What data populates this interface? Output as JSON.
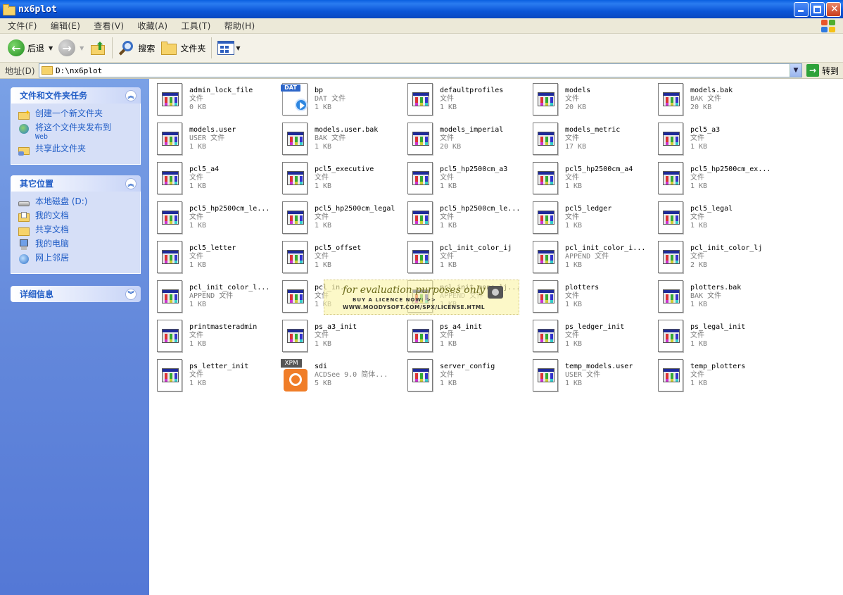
{
  "window": {
    "title": "nx6plot"
  },
  "menu": [
    "文件(F)",
    "编辑(E)",
    "查看(V)",
    "收藏(A)",
    "工具(T)",
    "帮助(H)"
  ],
  "toolbar": {
    "back_label": "后退",
    "search_label": "搜索",
    "folders_label": "文件夹"
  },
  "address": {
    "label": "地址(D)",
    "path": "D:\\nx6plot",
    "go_label": "转到"
  },
  "left_pane": {
    "tasks_title": "文件和文件夹任务",
    "tasks": [
      {
        "label": "创建一个新文件夹",
        "sub": ""
      },
      {
        "label": "将这个文件夹发布到",
        "sub": "Web"
      },
      {
        "label": "共享此文件夹",
        "sub": ""
      }
    ],
    "places_title": "其它位置",
    "places": [
      "本地磁盘 (D:)",
      "我的文档",
      "共享文档",
      "我的电脑",
      "网上邻居"
    ],
    "details_title": "详细信息"
  },
  "files": [
    {
      "name": "admin_lock_file",
      "type": "文件",
      "size": "0 KB",
      "icon": "doc"
    },
    {
      "name": "bp",
      "type": "DAT 文件",
      "size": "1 KB",
      "icon": "dat"
    },
    {
      "name": "defaultprofiles",
      "type": "文件",
      "size": "1 KB",
      "icon": "doc"
    },
    {
      "name": "models",
      "type": "文件",
      "size": "20 KB",
      "icon": "doc"
    },
    {
      "name": "models.bak",
      "type": "BAK 文件",
      "size": "20 KB",
      "icon": "doc"
    },
    {
      "name": "models.user",
      "type": "USER 文件",
      "size": "1 KB",
      "icon": "doc"
    },
    {
      "name": "models.user.bak",
      "type": "BAK 文件",
      "size": "1 KB",
      "icon": "doc"
    },
    {
      "name": "models_imperial",
      "type": "文件",
      "size": "20 KB",
      "icon": "doc"
    },
    {
      "name": "models_metric",
      "type": "文件",
      "size": "17 KB",
      "icon": "doc"
    },
    {
      "name": "pcl5_a3",
      "type": "文件",
      "size": "1 KB",
      "icon": "doc"
    },
    {
      "name": "pcl5_a4",
      "type": "文件",
      "size": "1 KB",
      "icon": "doc"
    },
    {
      "name": "pcl5_executive",
      "type": "文件",
      "size": "1 KB",
      "icon": "doc"
    },
    {
      "name": "pcl5_hp2500cm_a3",
      "type": "文件",
      "size": "1 KB",
      "icon": "doc"
    },
    {
      "name": "pcl5_hp2500cm_a4",
      "type": "文件",
      "size": "1 KB",
      "icon": "doc"
    },
    {
      "name": "pcl5_hp2500cm_ex...",
      "type": "文件",
      "size": "1 KB",
      "icon": "doc"
    },
    {
      "name": "pcl5_hp2500cm_le...",
      "type": "文件",
      "size": "1 KB",
      "icon": "doc"
    },
    {
      "name": "pcl5_hp2500cm_legal",
      "type": "文件",
      "size": "1 KB",
      "icon": "doc"
    },
    {
      "name": "pcl5_hp2500cm_le...",
      "type": "文件",
      "size": "1 KB",
      "icon": "doc"
    },
    {
      "name": "pcl5_ledger",
      "type": "文件",
      "size": "1 KB",
      "icon": "doc"
    },
    {
      "name": "pcl5_legal",
      "type": "文件",
      "size": "1 KB",
      "icon": "doc"
    },
    {
      "name": "pcl5_letter",
      "type": "文件",
      "size": "1 KB",
      "icon": "doc"
    },
    {
      "name": "pcl5_offset",
      "type": "文件",
      "size": "1 KB",
      "icon": "doc"
    },
    {
      "name": "pcl_init_color_ij",
      "type": "文件",
      "size": "1 KB",
      "icon": "doc"
    },
    {
      "name": "pcl_init_color_i...",
      "type": "APPEND 文件",
      "size": "1 KB",
      "icon": "doc"
    },
    {
      "name": "pcl_init_color_lj",
      "type": "文件",
      "size": "2 KB",
      "icon": "doc"
    },
    {
      "name": "pcl_init_color_l...",
      "type": "APPEND 文件",
      "size": "1 KB",
      "icon": "doc"
    },
    {
      "name": "pcl_in...",
      "type": "文件",
      "size": "1 KB",
      "icon": "doc"
    },
    {
      "name": "pcl_init_mono_lj...",
      "type": "APPEND 文件",
      "size": "1 KB",
      "icon": "doc"
    },
    {
      "name": "plotters",
      "type": "文件",
      "size": "1 KB",
      "icon": "doc"
    },
    {
      "name": "plotters.bak",
      "type": "BAK 文件",
      "size": "1 KB",
      "icon": "doc"
    },
    {
      "name": "printmasteradmin",
      "type": "文件",
      "size": "1 KB",
      "icon": "doc"
    },
    {
      "name": "ps_a3_init",
      "type": "文件",
      "size": "1 KB",
      "icon": "doc"
    },
    {
      "name": "ps_a4_init",
      "type": "文件",
      "size": "1 KB",
      "icon": "doc"
    },
    {
      "name": "ps_ledger_init",
      "type": "文件",
      "size": "1 KB",
      "icon": "doc"
    },
    {
      "name": "ps_legal_init",
      "type": "文件",
      "size": "1 KB",
      "icon": "doc"
    },
    {
      "name": "ps_letter_init",
      "type": "文件",
      "size": "1 KB",
      "icon": "doc"
    },
    {
      "name": "sdi",
      "type": "ACDSee 9.0 简体...",
      "size": "5 KB",
      "icon": "xpm"
    },
    {
      "name": "server_config",
      "type": "文件",
      "size": "1 KB",
      "icon": "doc"
    },
    {
      "name": "temp_models.user",
      "type": "USER 文件",
      "size": "1 KB",
      "icon": "doc"
    },
    {
      "name": "temp_plotters",
      "type": "文件",
      "size": "1 KB",
      "icon": "doc"
    }
  ],
  "icon_badges": {
    "dat": "DAT",
    "xpm": "XPM"
  },
  "watermark": {
    "main": "for evaluation purposes only",
    "line1": "BUY A LICENCE NOW: >>",
    "line2": "WWW.MOODYSOFT.COM/SPX/LICENSE.HTML"
  },
  "colors": {
    "titlebar": "#0b56d8",
    "sidebar": "#6388db",
    "link": "#215dc6"
  }
}
